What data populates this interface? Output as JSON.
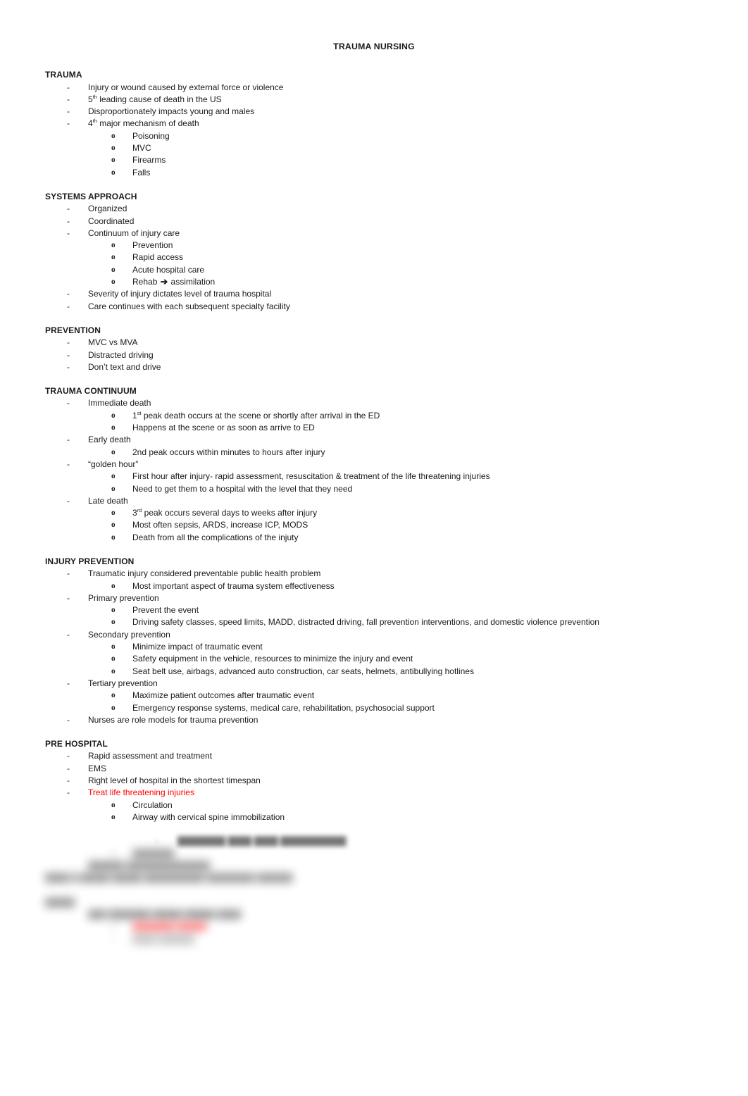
{
  "document": {
    "title": "TRAUMA NURSING",
    "accent_red": "#ff0000",
    "text_color": "#1a1a1a",
    "background": "#ffffff"
  },
  "sections": [
    {
      "heading": "TRAUMA",
      "items": [
        {
          "text": "Injury or wound caused by external force or violence"
        },
        {
          "text_pre": "5",
          "sup": "th",
          "text_post": " leading cause of death in the US"
        },
        {
          "text": "Disproportionately impacts young and males"
        },
        {
          "text_pre": "4",
          "sup": "th",
          "text_post": " major mechanism of death"
        }
      ],
      "sub_items": [
        {
          "text": "Poisoning"
        },
        {
          "text": "MVC"
        },
        {
          "text": "Firearms"
        },
        {
          "text": "Falls"
        }
      ]
    },
    {
      "heading": "SYSTEMS APPROACH",
      "items": [
        {
          "text": "Organized"
        },
        {
          "text": "Coordinated"
        },
        {
          "text": "Continuum of injury care"
        }
      ],
      "sub_items": [
        {
          "text": "Prevention"
        },
        {
          "text": "Rapid access"
        },
        {
          "text": "Acute hospital care"
        },
        {
          "text_pre": "Rehab ",
          "arrow": "➔",
          "text_post": " assimilation"
        }
      ],
      "tail_items": [
        {
          "text": "Severity of injury dictates level of trauma hospital"
        },
        {
          "text": "Care continues with each subsequent specialty facility"
        }
      ]
    },
    {
      "heading": "PREVENTION",
      "items": [
        {
          "text": "MVC vs MVA"
        },
        {
          "text": "Distracted driving"
        },
        {
          "text": "Don’t text and drive"
        }
      ]
    },
    {
      "heading": "TRAUMA CONTINUUM",
      "groups": [
        {
          "parent": "Immediate death",
          "children": [
            {
              "text_pre": "1",
              "sup": "st",
              "text_post": " peak death occurs at the scene or shortly after arrival in the ED"
            },
            {
              "text": "Happens at the scene or as soon as arrive to ED"
            }
          ]
        },
        {
          "parent": "Early death",
          "children": [
            {
              "text": "2nd peak occurs within minutes to hours after injury"
            }
          ]
        },
        {
          "parent": "“golden hour”",
          "children": [
            {
              "text": "First hour after injury- rapid assessment, resuscitation & treatment of the life threatening injuries"
            },
            {
              "text": "Need to get them to a hospital with the level that they need"
            }
          ]
        },
        {
          "parent": "Late death",
          "children": [
            {
              "text_pre": "3",
              "sup": "rd",
              "text_post": " peak occurs several days to weeks after injury"
            },
            {
              "text": "Most often sepsis, ARDS, increase ICP, MODS"
            },
            {
              "text": "Death from all the complications of the injuty"
            }
          ]
        }
      ]
    },
    {
      "heading": "INJURY PREVENTION",
      "groups": [
        {
          "parent": "Traumatic injury considered preventable public health problem",
          "children": [
            {
              "text": "Most important aspect of trauma system effectiveness"
            }
          ]
        },
        {
          "parent": "Primary prevention",
          "children": [
            {
              "text": "Prevent the event"
            },
            {
              "text": "Driving safety classes, speed limits, MADD, distracted driving, fall prevention interventions, and domestic violence prevention"
            }
          ]
        },
        {
          "parent": "Secondary prevention",
          "children": [
            {
              "text": "Minimize impact of traumatic event"
            },
            {
              "text": "Safety equipment in the vehicle, resources to minimize the injury and event"
            },
            {
              "text": "Seat belt use, airbags, advanced auto construction, car seats, helmets, antibullying hotlines"
            }
          ]
        },
        {
          "parent": "Tertiary prevention",
          "children": [
            {
              "text": "Maximize patient outcomes after traumatic event"
            },
            {
              "text": "Emergency response systems, medical care, rehabilitation, psychosocial support"
            }
          ]
        }
      ],
      "tail_items": [
        {
          "text": "Nurses are role models for trauma prevention"
        }
      ]
    },
    {
      "heading": "PRE HOSPITAL",
      "items": [
        {
          "text": "Rapid assessment and treatment"
        },
        {
          "text": "EMS"
        },
        {
          "text": "Right level of hospital in the shortest timespan"
        },
        {
          "text": "Treat life threatening injuries",
          "color": "red"
        }
      ],
      "sub_items": [
        {
          "text": "Circulation"
        },
        {
          "text": "Airway with cervical spine immobilization"
        }
      ]
    }
  ],
  "obscured": {
    "note": "Remaining content is blurred and unreadable in the source image.",
    "lines": [
      {
        "level": 3,
        "length": 52,
        "blur": "light"
      },
      {
        "level": 2,
        "length": 18,
        "blur": "heavy"
      },
      {
        "level": 1,
        "length": 40,
        "blur": "heavy"
      },
      {
        "level": 0,
        "length": 62,
        "blur": "heavy"
      },
      {
        "level": 0,
        "length": 6,
        "blur": "heavy",
        "gap_before": true
      },
      {
        "level": 1,
        "length": 38,
        "blur": "heavy"
      },
      {
        "level": 2,
        "length": 20,
        "blur": "heavy",
        "color": "red"
      },
      {
        "level": 2,
        "length": 14,
        "blur": "faint"
      }
    ]
  }
}
